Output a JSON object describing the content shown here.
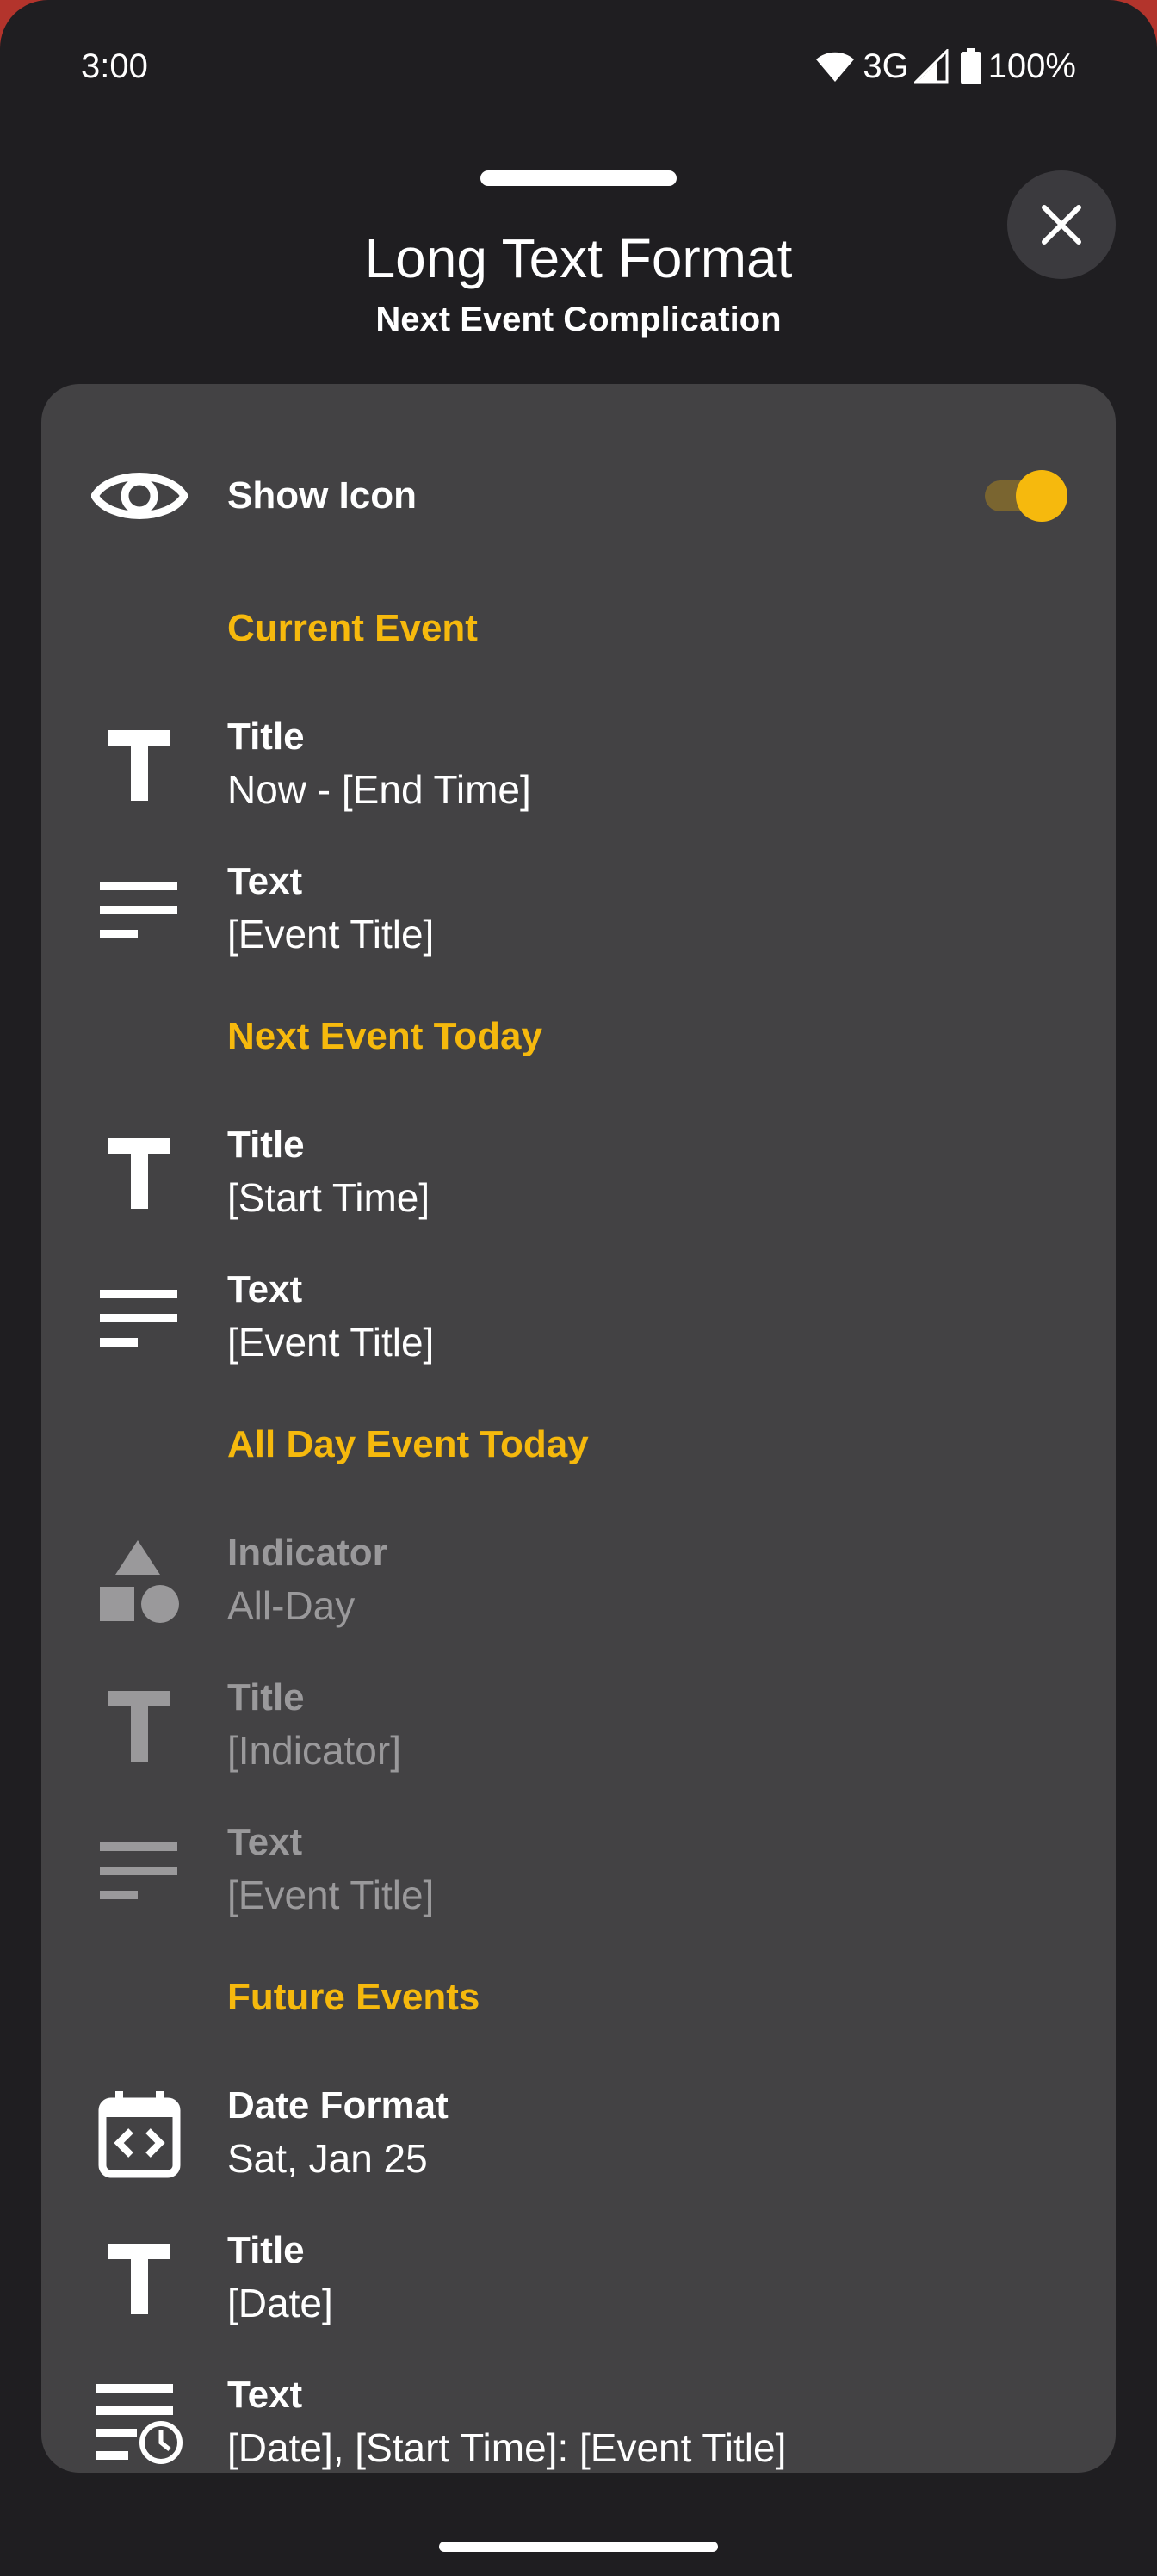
{
  "status_bar": {
    "time": "3:00",
    "network": "3G",
    "battery": "100%",
    "icons": [
      "wifi-icon",
      "signal-icon",
      "battery-icon"
    ]
  },
  "header": {
    "title": "Long Text Format",
    "subtitle": "Next Event Complication",
    "close_icon": "close-icon"
  },
  "show_icon": {
    "label": "Show Icon",
    "icon": "eye-icon",
    "enabled": true
  },
  "sections": {
    "current_event": {
      "header": "Current Event",
      "title_label": "Title",
      "title_value": "Now - [End Time]",
      "text_label": "Text",
      "text_value": "[Event Title]"
    },
    "next_event_today": {
      "header": "Next Event Today",
      "title_label": "Title",
      "title_value": "[Start Time]",
      "text_label": "Text",
      "text_value": "[Event Title]"
    },
    "all_day_event_today": {
      "header": "All Day Event Today",
      "indicator_label": "Indicator",
      "indicator_value": "All-Day",
      "title_label": "Title",
      "title_value": "[Indicator]",
      "text_label": "Text",
      "text_value": "[Event Title]"
    },
    "future_events": {
      "header": "Future Events",
      "date_format_label": "Date Format",
      "date_format_value": "Sat, Jan 25",
      "title_label": "Title",
      "title_value": "[Date]",
      "text_label": "Text",
      "text_value": "[Date], [Start Time]: [Event Title]"
    }
  },
  "colors": {
    "background": "#1f1e21",
    "card": "#434244",
    "accent": "#f6b90d",
    "text": "#ffffff",
    "disabled_text": "#9a999b"
  }
}
